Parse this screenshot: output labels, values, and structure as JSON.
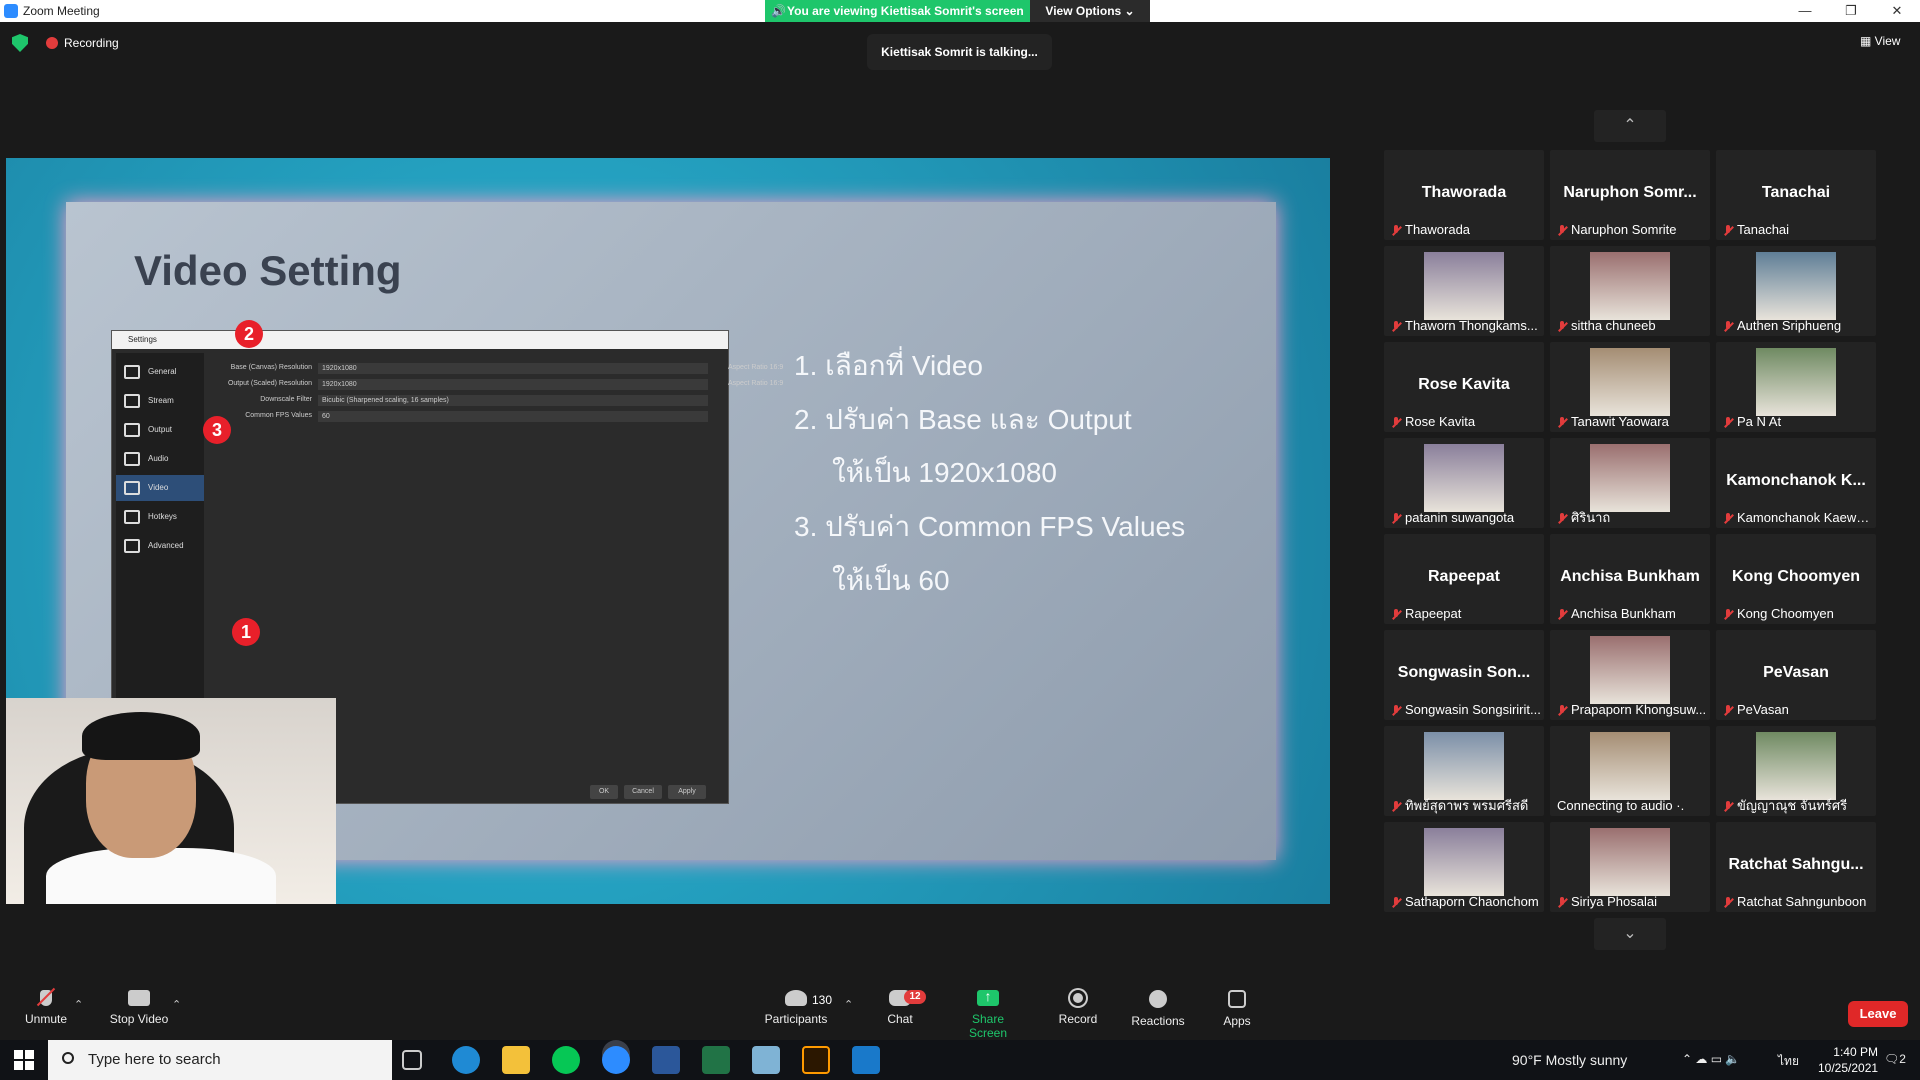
{
  "window": {
    "title": "Zoom Meeting"
  },
  "banner": {
    "viewing": "You are viewing Kiettisak Somrit's screen",
    "view_options": "View Options ⌄"
  },
  "status": {
    "recording": "Recording",
    "talking": "Kiettisak Somrit is talking...",
    "view": "View"
  },
  "slide": {
    "title": "Video Setting",
    "steps": [
      "1.  เลือกที่ Video",
      "2.  ปรับค่า Base และ Output",
      "ให้เป็น 1920x1080",
      "3.  ปรับค่า Common FPS Values",
      "ให้เป็น 60"
    ],
    "settings_window": {
      "title": "Settings",
      "sidebar": [
        "General",
        "Stream",
        "Output",
        "Audio",
        "Video",
        "Hotkeys",
        "Advanced"
      ],
      "rows": [
        {
          "label": "Base (Canvas) Resolution",
          "value": "1920x1080",
          "aspect": "Aspect Ratio 16:9"
        },
        {
          "label": "Output (Scaled) Resolution",
          "value": "1920x1080",
          "aspect": "Aspect Ratio 16:9"
        },
        {
          "label": "Downscale Filter",
          "value": "Bicubic (Sharpened scaling, 16 samples)",
          "aspect": ""
        },
        {
          "label": "Common FPS Values",
          "value": "60",
          "aspect": ""
        }
      ],
      "buttons": [
        "OK",
        "Cancel",
        "Apply"
      ],
      "badges": [
        "1",
        "2",
        "3"
      ]
    }
  },
  "gallery": {
    "tiles": [
      {
        "big": "Thaworada",
        "name": "Thaworada",
        "has_video": false
      },
      {
        "big": "Naruphon  Somr...",
        "name": "Naruphon Somrite",
        "has_video": false
      },
      {
        "big": "Tanachai",
        "name": "Tanachai",
        "has_video": false
      },
      {
        "big": "",
        "name": "Thaworn Thongkams...",
        "has_video": true
      },
      {
        "big": "",
        "name": "sittha chuneeb",
        "has_video": true
      },
      {
        "big": "",
        "name": "Authen Sriphueng",
        "has_video": true
      },
      {
        "big": "Rose Kavita",
        "name": "Rose Kavita",
        "has_video": false
      },
      {
        "big": "",
        "name": "Tanawit Yaowara",
        "has_video": true
      },
      {
        "big": "",
        "name": "Pa N At",
        "has_video": true
      },
      {
        "big": "",
        "name": "patanin suwangota",
        "has_video": true
      },
      {
        "big": "",
        "name": "ศิรินาถ",
        "has_video": true
      },
      {
        "big": "Kamonchanok  K...",
        "name": "Kamonchanok Kaews...",
        "has_video": false
      },
      {
        "big": "Rapeepat",
        "name": "Rapeepat",
        "has_video": false
      },
      {
        "big": "Anchisa Bunkham",
        "name": "Anchisa Bunkham",
        "has_video": false
      },
      {
        "big": "Kong Choomyen",
        "name": "Kong Choomyen",
        "has_video": false
      },
      {
        "big": "Songwasin  Son...",
        "name": "Songwasin Songsiririt...",
        "has_video": false
      },
      {
        "big": "",
        "name": "Prapaporn Khongsuw...",
        "has_video": true
      },
      {
        "big": "PeVasan",
        "name": "PeVasan",
        "has_video": false
      },
      {
        "big": "",
        "name": "ทิพย์สุดาพร พรมศรีสดี",
        "has_video": true
      },
      {
        "big": "",
        "name": "Connecting to audio ·.",
        "has_video": true,
        "no_mic": true
      },
      {
        "big": "",
        "name": "ขัญญาณุช จันทร์ศรี",
        "has_video": true
      },
      {
        "big": "",
        "name": "Sathaporn Chaonchom",
        "has_video": true
      },
      {
        "big": "",
        "name": "Siriya Phosalai",
        "has_video": true
      },
      {
        "big": "Ratchat  Sahngu...",
        "name": "Ratchat Sahngunboon",
        "has_video": false
      }
    ]
  },
  "toolbar": {
    "unmute": "Unmute",
    "stop_video": "Stop Video",
    "participants": "Participants",
    "participants_count": "130",
    "chat": "Chat",
    "chat_badge": "12",
    "share_screen": "Share Screen",
    "record": "Record",
    "reactions": "Reactions",
    "apps": "Apps",
    "leave": "Leave"
  },
  "taskbar": {
    "search_placeholder": "Type here to search",
    "weather": "90°F  Mostly sunny",
    "lang": "ไทย",
    "time": "1:40 PM",
    "date": "10/25/2021",
    "notif": "2"
  },
  "colors": {
    "zoom_blue": "#2d8cff",
    "share_green": "#1ec66b",
    "leave_red": "#e02828",
    "badge_red": "#e8202a"
  }
}
